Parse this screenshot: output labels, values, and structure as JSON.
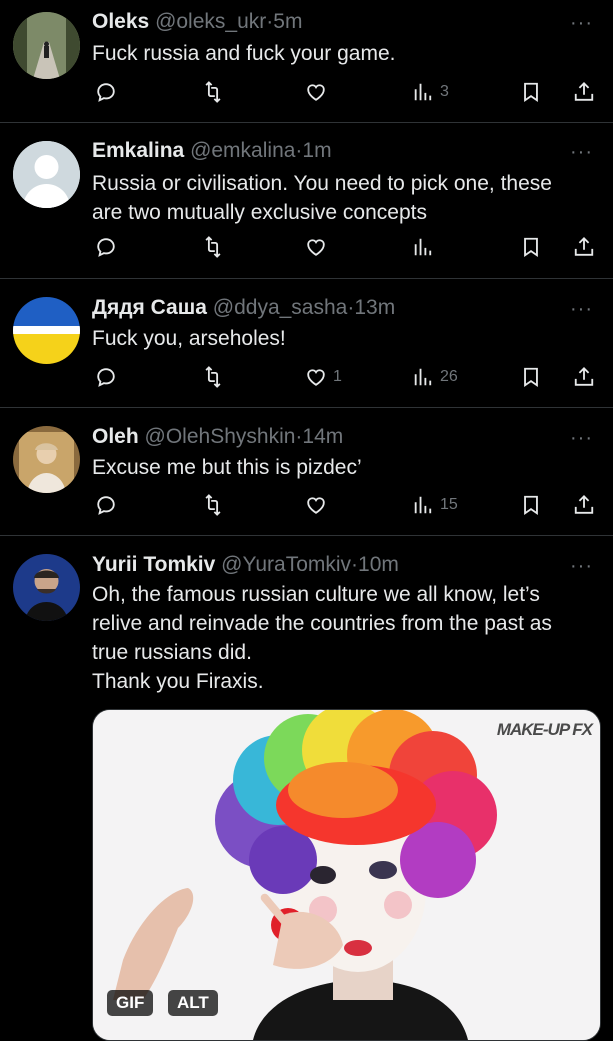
{
  "tweets": [
    {
      "name": "Oleks",
      "handle": "@oleks_ukr",
      "time": "5m",
      "lines": [
        "Fuck russia and fuck your game."
      ],
      "likes": "",
      "views": "3",
      "avatar_icon": "forest-road-photo"
    },
    {
      "name": "Emkalina",
      "handle": "@emkalina",
      "time": "1m",
      "lines": [
        "Russia or civilisation. You need to pick one, these",
        "are two mutually exclusive concepts"
      ],
      "likes": "",
      "views": "",
      "avatar_icon": "default-profile-silhouette"
    },
    {
      "name": "Дядя Саша",
      "handle": "@ddya_sasha",
      "time": "13m",
      "lines": [
        "Fuck you, arseholes!"
      ],
      "likes": "1",
      "views": "26",
      "avatar_icon": "ukraine-flag"
    },
    {
      "name": "Oleh",
      "handle": "@OlehShyshkin",
      "time": "14m",
      "lines": [
        "Excuse me but this is pizdec’"
      ],
      "likes": "",
      "views": "15",
      "avatar_icon": "person-portrait"
    },
    {
      "name": "Yurii Tomkiv",
      "handle": "@YuraTomkiv",
      "time": "10m",
      "lines": [
        "Oh, the famous russian culture we all know, let’s",
        "relive and reinvade the countries from the past as",
        "true russians did.",
        "Thank you Firaxis."
      ],
      "likes": "",
      "views": "",
      "avatar_icon": "person-portrait"
    }
  ],
  "separator": "·",
  "more_icon": "···",
  "media": {
    "watermark": "MAKE-UP FX",
    "gif_badge": "GIF",
    "alt_badge": "ALT",
    "description_icon": "clown-makeup-gif"
  },
  "colors": {
    "background": "#000000",
    "text": "#e7e9ea",
    "muted": "#71767b",
    "divider": "#2f3336"
  }
}
